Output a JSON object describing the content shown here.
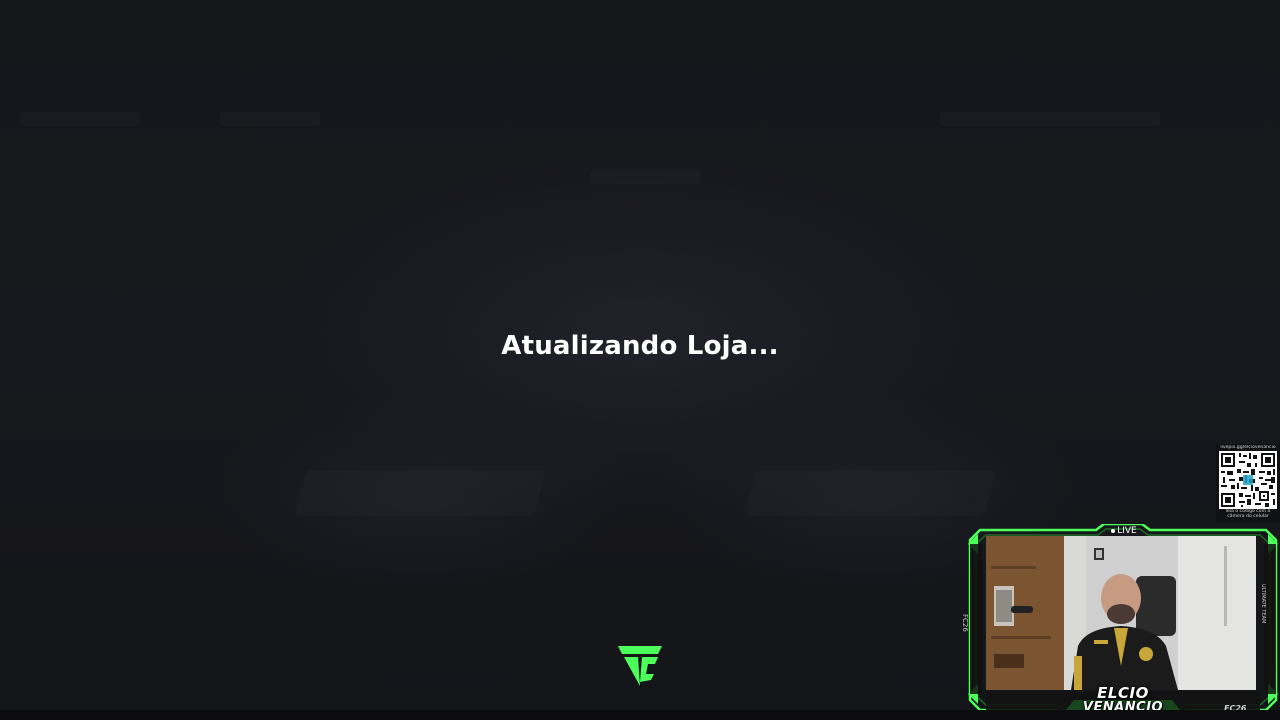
{
  "screen": {
    "status_text": "Atualizando Loja...",
    "background_color": "#16171b",
    "accent_color": "#4cff5a"
  },
  "logo": {
    "icon": "fc-logo-icon",
    "color": "#4cff5a"
  },
  "qr_widget": {
    "url_text": "livepix.gg/elciovenancio",
    "caption": "leia o código com a câmera do celular",
    "icon": "qr-code-icon"
  },
  "webcam": {
    "live_label": "LIVE",
    "streamer_first_name": "ELCIO",
    "streamer_last_name": "VENANCIO",
    "left_tag": "FC26",
    "right_tag": "ULTIMATE TEAM",
    "corner_tag": "FC26",
    "frame_color": "#4cff5a"
  }
}
